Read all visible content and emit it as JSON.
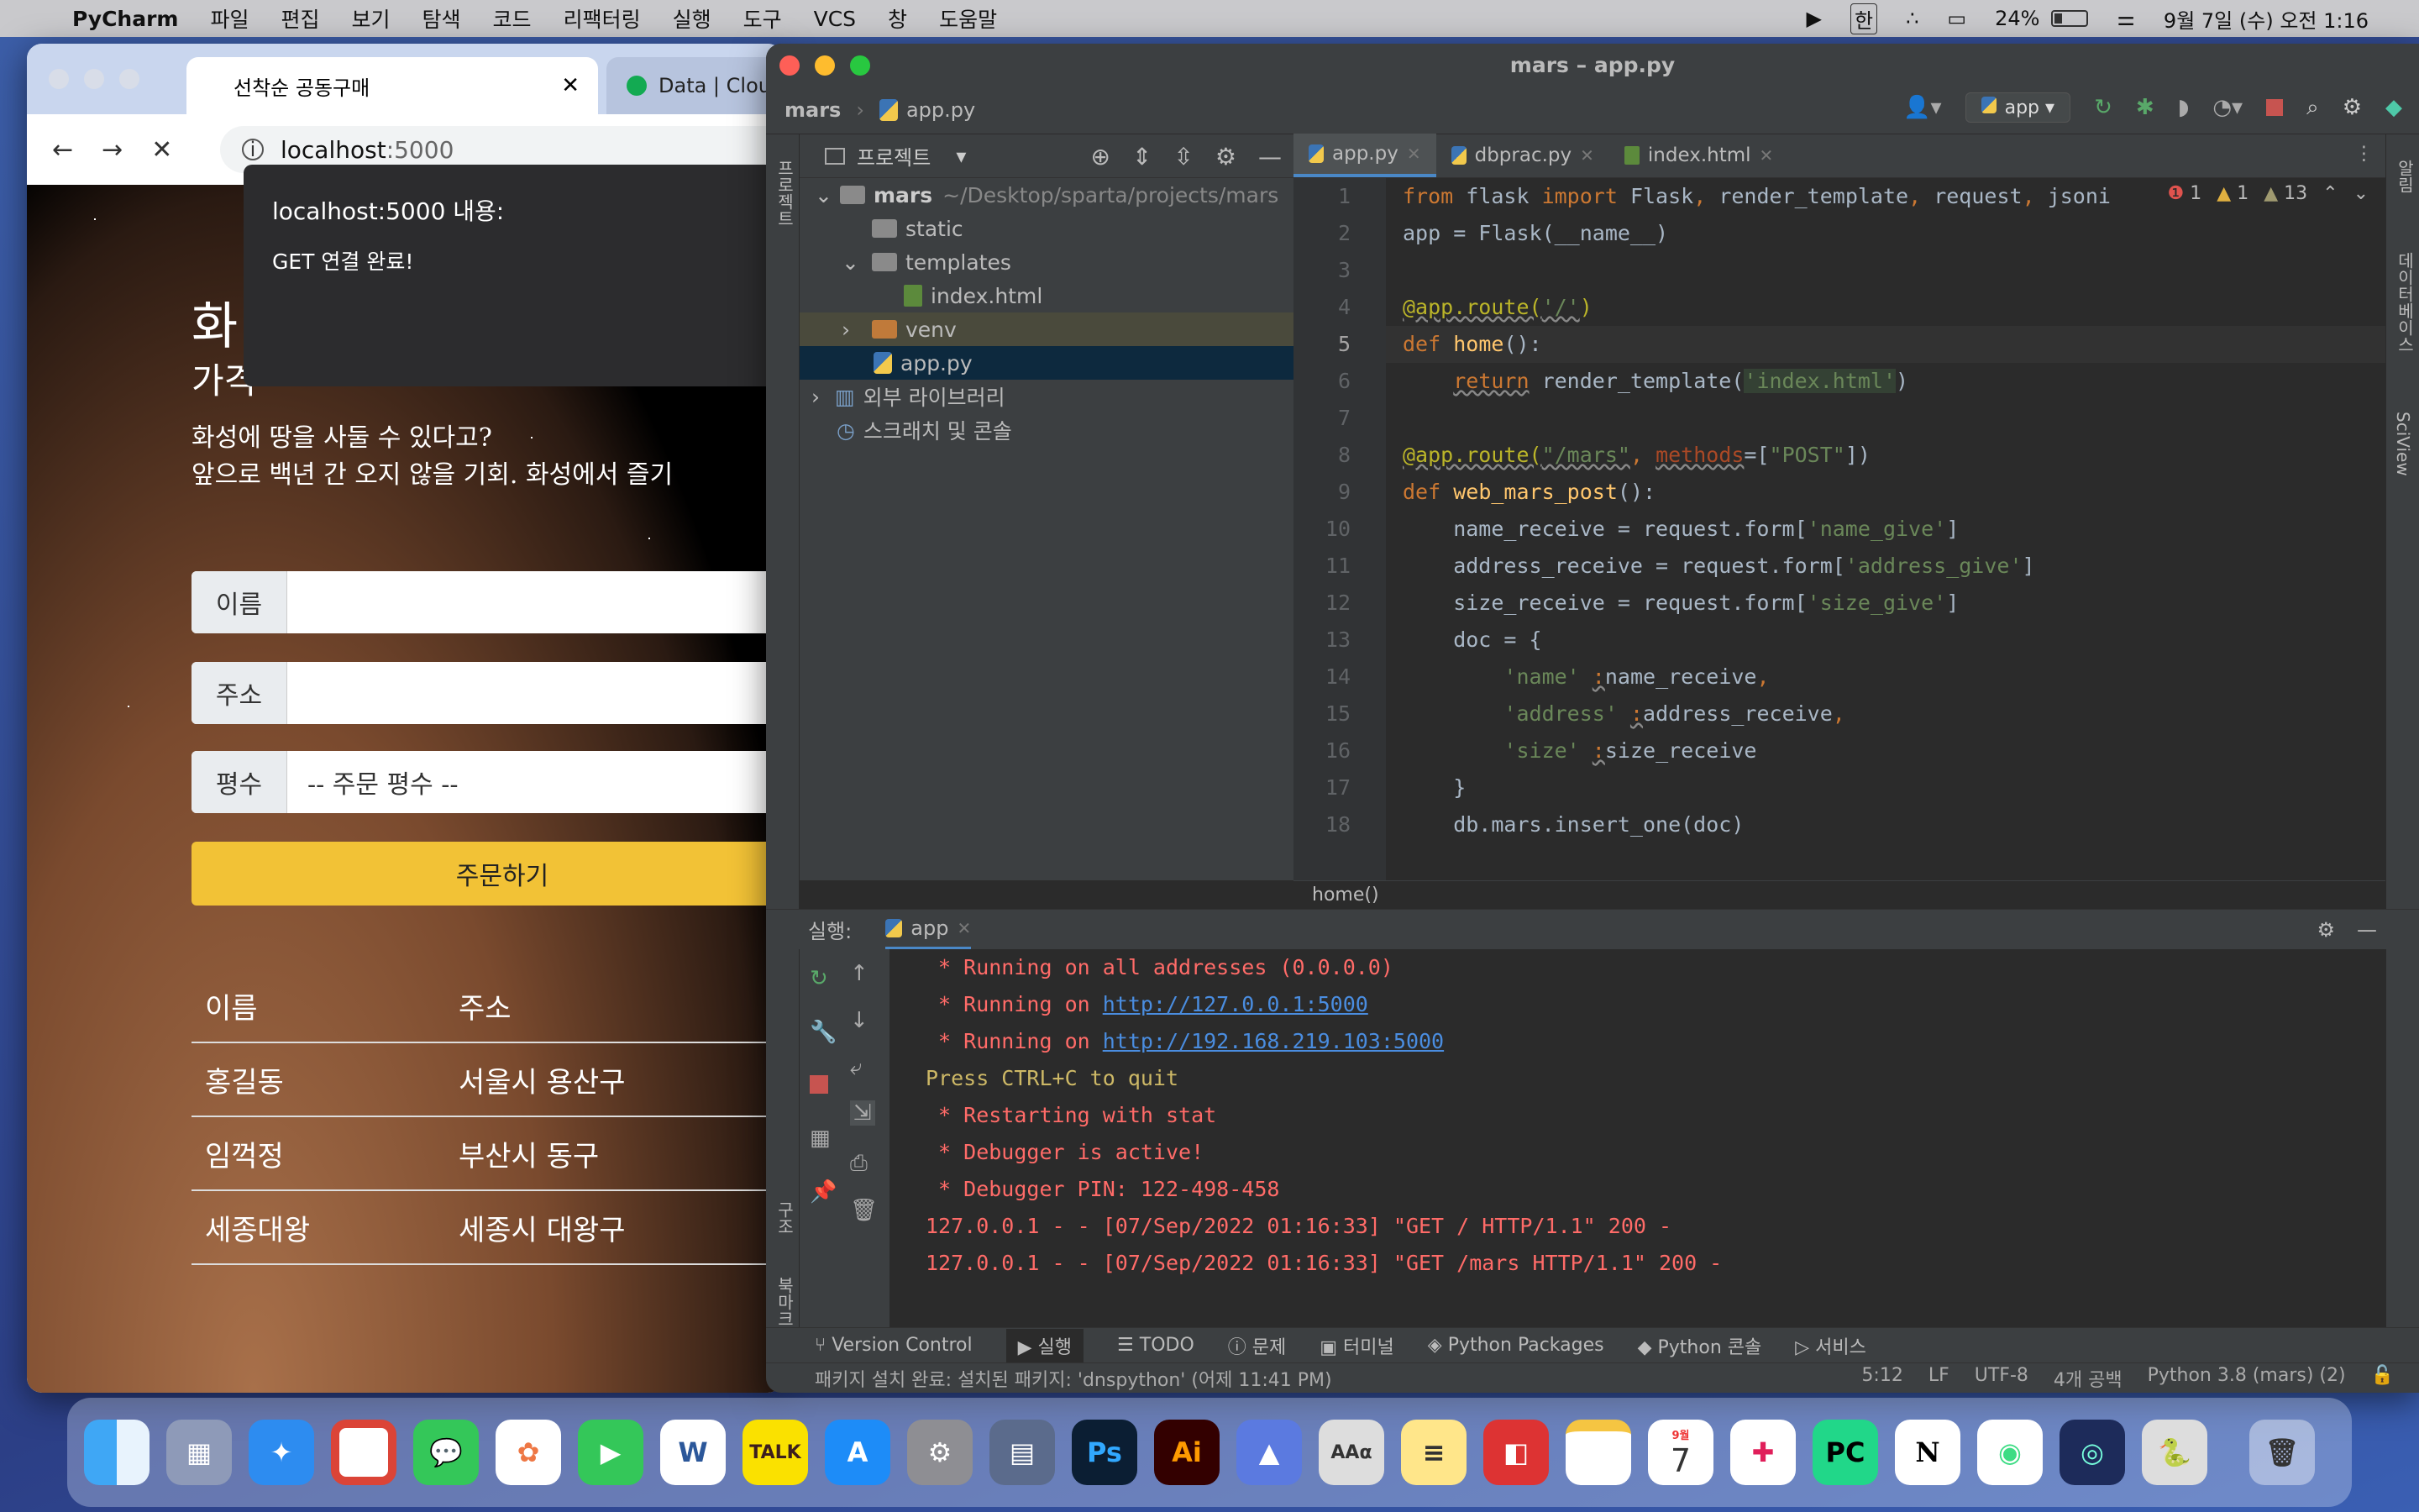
{
  "menubar": {
    "app": "PyCharm",
    "items": [
      "파일",
      "편집",
      "보기",
      "탐색",
      "코드",
      "리팩터링",
      "실행",
      "도구",
      "VCS",
      "창",
      "도움말"
    ],
    "ime": "한",
    "battery": "24%",
    "clock": "9월 7일 (수) 오전 1:16"
  },
  "browser": {
    "tab1": "선착순 공동구매",
    "tab2": "Data | Cloud",
    "url_host": "localhost",
    "url_port": ":5000",
    "alert": {
      "title": "localhost:5000 내용:",
      "message": "GET 연결 완료!"
    },
    "page": {
      "title": "화",
      "subtitle": "가격",
      "desc1": "화성에 땅을 사둘 수 있다고?",
      "desc2": "앞으로 백년 간 오지 않을 기회. 화성에서 즐기",
      "name_label": "이름",
      "address_label": "주소",
      "count_label": "평수",
      "count_value": "-- 주문 평수 --",
      "order_button": "주문하기",
      "table": {
        "headers": [
          "이름",
          "주소"
        ],
        "rows": [
          [
            "홍길동",
            "서울시 용산구"
          ],
          [
            "임꺽정",
            "부산시 동구"
          ],
          [
            "세종대왕",
            "세종시 대왕구"
          ]
        ]
      }
    }
  },
  "pycharm": {
    "window_title": "mars – app.py",
    "breadcrumb": [
      "mars",
      "app.py"
    ],
    "run_config": "app",
    "project_label": "프로젝트",
    "side_project": "프로젝트",
    "side_structure": "구조",
    "side_bookmarks": "북마크",
    "side_notifications": "알림",
    "side_database": "데이터베이스",
    "side_sciview": "SciView",
    "tree": [
      {
        "label": "mars",
        "extra": "~/Desktop/sparta/projects/mars"
      },
      {
        "label": "static"
      },
      {
        "label": "templates"
      },
      {
        "label": "index.html"
      },
      {
        "label": "venv"
      },
      {
        "label": "app.py"
      },
      {
        "label": "외부 라이브러리"
      },
      {
        "label": "스크래치 및 콘솔"
      }
    ],
    "tabs": [
      "app.py",
      "dbprac.py",
      "index.html"
    ],
    "inspections": {
      "errors": "1",
      "warnings": "1",
      "weak": "13"
    },
    "code_breadcrumb": "home()",
    "line_numbers": [
      "1",
      "2",
      "3",
      "4",
      "5",
      "6",
      "7",
      "8",
      "9",
      "10",
      "11",
      "12",
      "13",
      "14",
      "15",
      "16",
      "17",
      "18"
    ],
    "run_label": "실행:",
    "run_tab": "app",
    "console": {
      "l1": " * Running on all addresses (0.0.0.0)",
      "l2_pre": " * Running on ",
      "l2_link": "http://127.0.0.1:5000",
      "l3_pre": " * Running on ",
      "l3_link": "http://192.168.219.103:5000",
      "l4": "Press CTRL+C to quit",
      "l5": " * Restarting with stat",
      "l6": " * Debugger is active!",
      "l7": " * Debugger PIN: 122-498-458",
      "l8": "127.0.0.1 - - [07/Sep/2022 01:16:33] \"GET / HTTP/1.1\" 200 -",
      "l9": "127.0.0.1 - - [07/Sep/2022 01:16:33] \"GET /mars HTTP/1.1\" 200 -"
    },
    "toolwindows": [
      "Version Control",
      "실행",
      "TODO",
      "문제",
      "터미널",
      "Python Packages",
      "Python 콘솔",
      "서비스"
    ],
    "status_msg": "패키지 설치 완료: 설치된 패키지: 'dnspython' (어제 11:41 PM)",
    "status_right": [
      "5:12",
      "LF",
      "UTF-8",
      "4개 공백",
      "Python 3.8 (mars) (2)"
    ]
  },
  "dock": {
    "calendar_month": "9월",
    "calendar_day": "7",
    "talk": "TALK",
    "ps": "Ps",
    "ai": "Ai",
    "pc": "PC",
    "notion": "N",
    "word": "W",
    "font": "AAα"
  }
}
